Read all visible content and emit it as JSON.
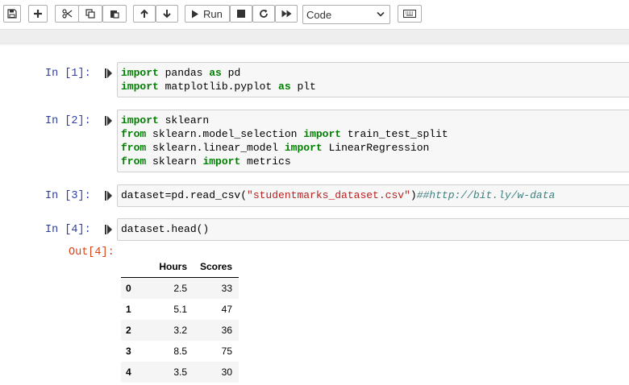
{
  "toolbar": {
    "run_label": "Run",
    "cell_type": "Code",
    "icons": [
      "save-icon",
      "plus-icon",
      "scissors-icon",
      "copy-icon",
      "paste-icon",
      "arrow-up-icon",
      "arrow-down-icon",
      "play-icon",
      "stop-icon",
      "restart-icon",
      "fast-forward-icon",
      "keyboard-icon"
    ]
  },
  "cells": [
    {
      "prompt": "In [1]:"
    },
    {
      "prompt": "In [2]:"
    },
    {
      "prompt": "In [3]:"
    },
    {
      "prompt": "In [4]:"
    }
  ],
  "code": {
    "c1l1": {
      "kw1": "import",
      "t1": " pandas ",
      "kw2": "as",
      "t2": " pd"
    },
    "c1l2": {
      "kw1": "import",
      "t1": " matplotlib.pyplot ",
      "kw2": "as",
      "t2": " plt"
    },
    "c2l1": {
      "kw1": "import",
      "t1": " sklearn"
    },
    "c2l2": {
      "kw1": "from",
      "t1": " sklearn.model_selection ",
      "kw2": "import",
      "t2": " train_test_split"
    },
    "c2l3": {
      "kw1": "from",
      "t1": " sklearn.linear_model ",
      "kw2": "import",
      "t2": " LinearRegression"
    },
    "c2l4": {
      "kw1": "from",
      "t1": " sklearn ",
      "kw2": "import",
      "t2": " metrics"
    },
    "c3l1": {
      "t1": "dataset=pd.read_csv(",
      "str": "\"studentmarks_dataset.csv\"",
      "t2": ")",
      "cmt": "##http://bit.ly/w-data"
    },
    "c4l1": {
      "t1": "dataset.head()"
    }
  },
  "output": {
    "prompt": "Out[4]:",
    "columns": [
      "",
      "Hours",
      "Scores"
    ],
    "rows": [
      {
        "index": "0",
        "hours": "2.5",
        "scores": "33"
      },
      {
        "index": "1",
        "hours": "5.1",
        "scores": "47"
      },
      {
        "index": "2",
        "hours": "3.2",
        "scores": "36"
      },
      {
        "index": "3",
        "hours": "8.5",
        "scores": "75"
      },
      {
        "index": "4",
        "hours": "3.5",
        "scores": "30"
      }
    ]
  }
}
